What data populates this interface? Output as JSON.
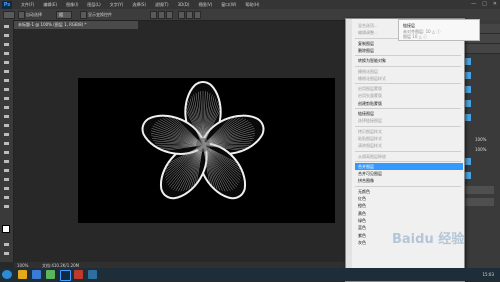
{
  "app": {
    "logo": "Ps"
  },
  "menubar": {
    "items": [
      "文件(F)",
      "编辑(E)",
      "图像(I)",
      "图层(L)",
      "文字(Y)",
      "选择(S)",
      "滤镜(T)",
      "3D(D)",
      "视图(V)",
      "窗口(W)",
      "帮助(H)"
    ],
    "controls": [
      "—",
      "□",
      "✕"
    ]
  },
  "options": {
    "auto_select_label": "自动选择",
    "auto_select_value": "组",
    "show_transform_label": "显示变换控件"
  },
  "document": {
    "tab_title": "未标题-1 @ 100% (图层 1, RGB/8) *"
  },
  "status": {
    "zoom": "100%",
    "doc_info": "文档:410.2K/1.20M"
  },
  "panels": {
    "opacity_value": "100%",
    "fill_value": "100%"
  },
  "context_menu": {
    "items": [
      {
        "label": "混合选项...",
        "enabled": false
      },
      {
        "label": "编辑调整...",
        "enabled": false
      },
      {
        "sep": true
      },
      {
        "label": "复制图层",
        "enabled": true
      },
      {
        "label": "删除图层",
        "enabled": true
      },
      {
        "sep": true
      },
      {
        "label": "转换为智能对象",
        "enabled": true
      },
      {
        "sep": true
      },
      {
        "label": "栅格化图层",
        "enabled": false
      },
      {
        "label": "栅格化图层样式",
        "enabled": false
      },
      {
        "sep": true
      },
      {
        "label": "启用图层蒙版",
        "enabled": false
      },
      {
        "label": "启用矢量蒙版",
        "enabled": false
      },
      {
        "label": "创建剪贴蒙版",
        "enabled": true
      },
      {
        "sep": true
      },
      {
        "label": "链接图层",
        "enabled": true
      },
      {
        "label": "选择链接图层",
        "enabled": false
      },
      {
        "sep": true
      },
      {
        "label": "拷贝图层样式",
        "enabled": false
      },
      {
        "label": "粘贴图层样式",
        "enabled": false
      },
      {
        "label": "清除图层样式",
        "enabled": false
      },
      {
        "sep": true
      },
      {
        "label": "从隔离图层释放",
        "enabled": false
      },
      {
        "sep": true
      },
      {
        "label": "合并图层",
        "enabled": true,
        "selected": true
      },
      {
        "label": "合并可见图层",
        "enabled": true
      },
      {
        "label": "拼合图像",
        "enabled": true
      },
      {
        "sep": true
      },
      {
        "label": "无颜色",
        "enabled": true
      },
      {
        "label": "红色",
        "enabled": true
      },
      {
        "label": "橙色",
        "enabled": true
      },
      {
        "label": "黄色",
        "enabled": true
      },
      {
        "label": "绿色",
        "enabled": true
      },
      {
        "label": "蓝色",
        "enabled": true
      },
      {
        "label": "紫色",
        "enabled": true
      },
      {
        "label": "灰色",
        "enabled": true
      }
    ]
  },
  "tooltip": {
    "title": "链接层",
    "line1": "未对齐图层: 10 △ ⓘ",
    "line2": "图层 10 △ ⓘ"
  },
  "taskbar": {
    "time": "15:03"
  },
  "watermark": {
    "text": "Baidu 经验"
  },
  "colors": {
    "accent": "#3399ff",
    "canvas": "#000000",
    "taskbar": "#1e2e38"
  }
}
